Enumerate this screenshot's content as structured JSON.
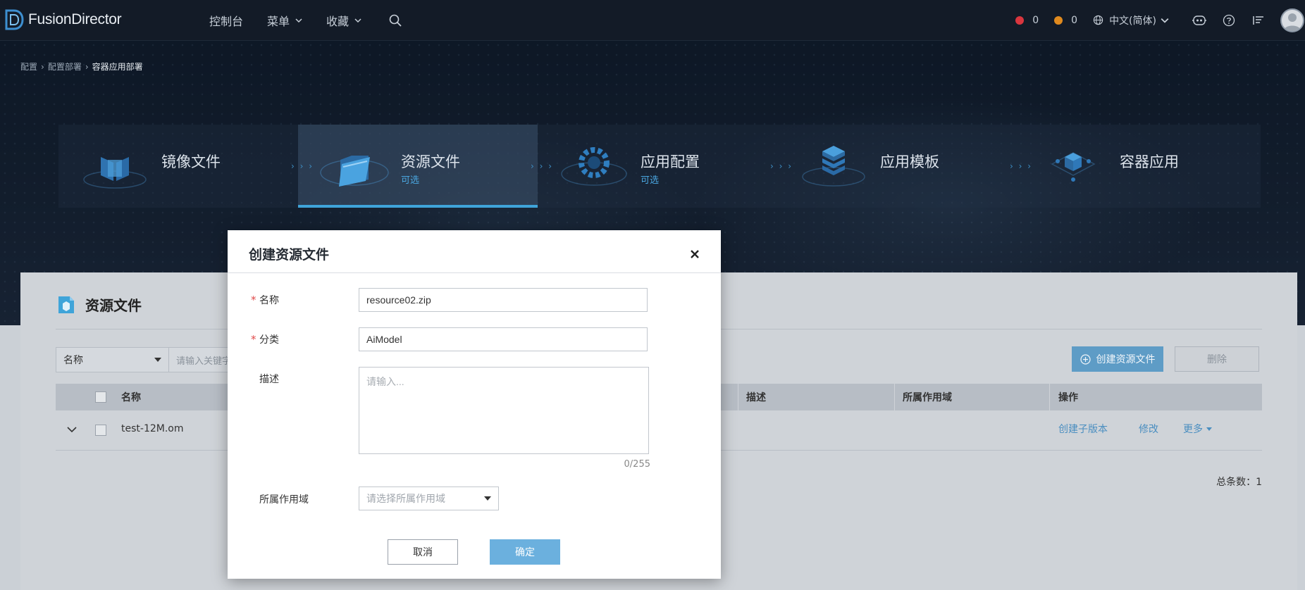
{
  "app": {
    "name": "FusionDirector",
    "colors": {
      "accent": "#3fa4d9",
      "header_bg": "#131b27",
      "primary_button": "#6bb0de"
    }
  },
  "topnav": {
    "items": [
      {
        "label": "控制台",
        "has_dropdown": false
      },
      {
        "label": "菜单",
        "has_dropdown": true
      },
      {
        "label": "收藏",
        "has_dropdown": true
      }
    ],
    "search_icon": "search-icon"
  },
  "topright": {
    "critical_count": "0",
    "major_count": "0",
    "language": "中文(简体)",
    "icons": [
      "globe-icon",
      "robot-assistant-icon",
      "help-icon",
      "task-list-icon",
      "user-avatar"
    ]
  },
  "breadcrumb": [
    "配置",
    "配置部署",
    "容器应用部署"
  ],
  "steps": [
    {
      "title": "镜像文件",
      "sub": "",
      "active": false,
      "icon": "image-file-icon"
    },
    {
      "title": "资源文件",
      "sub": "可选",
      "active": true,
      "icon": "resource-file-icon"
    },
    {
      "title": "应用配置",
      "sub": "可选",
      "active": false,
      "icon": "gear-config-icon"
    },
    {
      "title": "应用模板",
      "sub": "",
      "active": false,
      "icon": "template-stack-icon"
    },
    {
      "title": "容器应用",
      "sub": "",
      "active": false,
      "icon": "container-cube-icon"
    }
  ],
  "panel": {
    "title": "资源文件",
    "filter_field": "名称",
    "filter_placeholder": "请输入关键字",
    "create_label": "创建资源文件",
    "delete_label": "删除",
    "columns": [
      "名称",
      "描述",
      "所属作用域",
      "操作"
    ],
    "rows": [
      {
        "name": "test-12M.om",
        "description": "",
        "scope": "",
        "actions": [
          "创建子版本",
          "修改",
          "更多"
        ]
      }
    ],
    "total_label": "总条数：",
    "total_count": "1"
  },
  "modal": {
    "title": "创建资源文件",
    "fields": {
      "name": {
        "label": "名称",
        "value": "resource02.zip",
        "required": true
      },
      "category": {
        "label": "分类",
        "value": "AiModel",
        "required": true
      },
      "description": {
        "label": "描述",
        "placeholder": "请输入...",
        "counter": "0/255"
      },
      "scope": {
        "label": "所属作用域",
        "placeholder": "请选择所属作用域"
      }
    },
    "cancel_label": "取消",
    "ok_label": "确定"
  }
}
